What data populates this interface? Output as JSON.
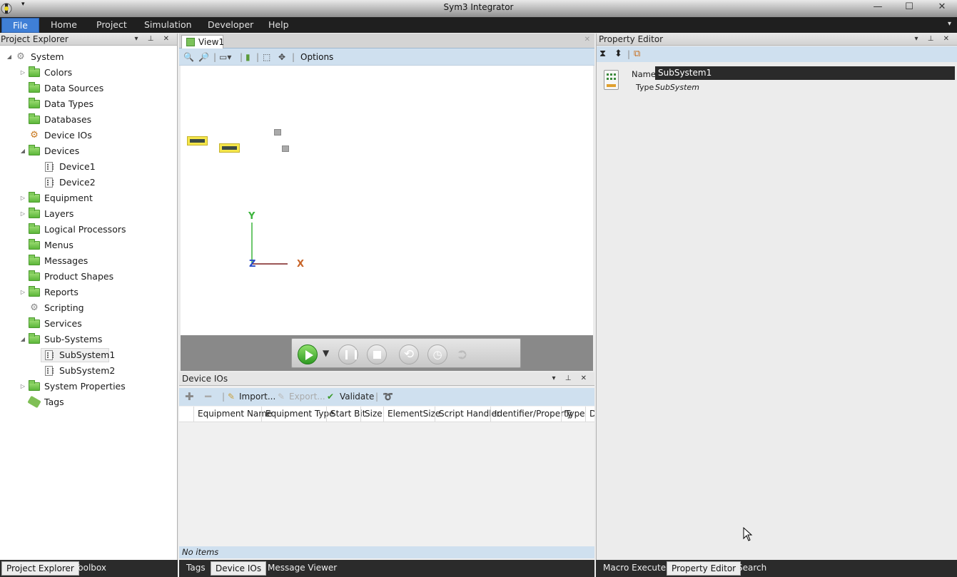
{
  "window": {
    "title": "Sym3 Integrator"
  },
  "menu": {
    "items": [
      "File",
      "Home",
      "Project",
      "Simulation",
      "Developer",
      "Help"
    ]
  },
  "project_explorer": {
    "title": "Project Explorer",
    "tree": [
      {
        "label": "System",
        "icon": "gear-icon",
        "expander": "expanded",
        "depth": 0
      },
      {
        "label": "Colors",
        "icon": "folder-icon",
        "expander": "collapsed",
        "depth": 1
      },
      {
        "label": "Data Sources",
        "icon": "folder-icon",
        "expander": "none",
        "depth": 1
      },
      {
        "label": "Data Types",
        "icon": "folder-icon",
        "expander": "none",
        "depth": 1
      },
      {
        "label": "Databases",
        "icon": "folder-icon",
        "expander": "none",
        "depth": 1
      },
      {
        "label": "Device IOs",
        "icon": "device-io-icon",
        "expander": "none",
        "depth": 1
      },
      {
        "label": "Devices",
        "icon": "folder-icon",
        "expander": "expanded",
        "depth": 1
      },
      {
        "label": "Device1",
        "icon": "device-icon",
        "expander": "none",
        "depth": 2
      },
      {
        "label": "Device2",
        "icon": "device-icon",
        "expander": "none",
        "depth": 2
      },
      {
        "label": "Equipment",
        "icon": "folder-icon",
        "expander": "collapsed",
        "depth": 1
      },
      {
        "label": "Layers",
        "icon": "folder-icon",
        "expander": "collapsed",
        "depth": 1
      },
      {
        "label": "Logical Processors",
        "icon": "folder-icon",
        "expander": "none",
        "depth": 1
      },
      {
        "label": "Menus",
        "icon": "folder-icon",
        "expander": "none",
        "depth": 1
      },
      {
        "label": "Messages",
        "icon": "folder-icon",
        "expander": "none",
        "depth": 1
      },
      {
        "label": "Product Shapes",
        "icon": "folder-icon",
        "expander": "none",
        "depth": 1
      },
      {
        "label": "Reports",
        "icon": "folder-icon",
        "expander": "collapsed",
        "depth": 1
      },
      {
        "label": "Scripting",
        "icon": "gear-icon",
        "expander": "none",
        "depth": 1
      },
      {
        "label": "Services",
        "icon": "folder-icon",
        "expander": "none",
        "depth": 1
      },
      {
        "label": "Sub-Systems",
        "icon": "folder-icon",
        "expander": "expanded",
        "depth": 1
      },
      {
        "label": "SubSystem1",
        "icon": "device-icon",
        "expander": "none",
        "depth": 2,
        "selected": true
      },
      {
        "label": "SubSystem2",
        "icon": "device-icon",
        "expander": "none",
        "depth": 2
      },
      {
        "label": "System Properties",
        "icon": "folder-icon",
        "expander": "collapsed",
        "depth": 1
      },
      {
        "label": "Tags",
        "icon": "tag-icon",
        "expander": "none",
        "depth": 1
      }
    ]
  },
  "view": {
    "tab": "View1",
    "toolbar": {
      "options_label": "Options"
    },
    "axes": {
      "x": "X",
      "y": "Y",
      "z": "Z"
    }
  },
  "device_ios": {
    "title": "Device IOs",
    "toolbar": {
      "import": "Import...",
      "export": "Export...",
      "validate": "Validate"
    },
    "columns": [
      "Equipment Name",
      "Equipment Type",
      "Start Bit",
      "Size",
      "ElementSize",
      "Script Handler",
      "Identifier/Property",
      "Type",
      "D"
    ],
    "status": "No items"
  },
  "property_editor": {
    "title": "Property Editor",
    "name_label": "Name",
    "name_value": "SubSystem1",
    "type_label": "Type",
    "type_value": "SubSystem"
  },
  "bottom_tabs": {
    "left": [
      "Project Explorer",
      "Toolbox"
    ],
    "center": [
      "Tags",
      "Device IOs",
      "Message Viewer"
    ],
    "right": [
      "Macro Executer",
      "Property Editor",
      "Search"
    ]
  }
}
